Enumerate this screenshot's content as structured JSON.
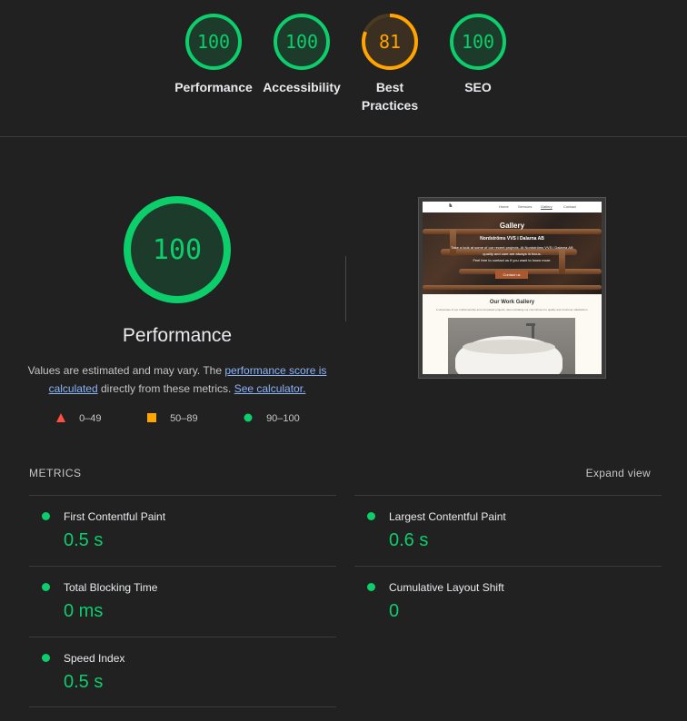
{
  "categories": [
    {
      "score": "100",
      "label_line1": "Performance",
      "label_line2": "",
      "color": "#0cce6b",
      "fraction": 1.0
    },
    {
      "score": "100",
      "label_line1": "Accessibility",
      "label_line2": "",
      "color": "#0cce6b",
      "fraction": 1.0
    },
    {
      "score": "81",
      "label_line1": "Best",
      "label_line2": "Practices",
      "color": "#ffa400",
      "fraction": 0.81
    },
    {
      "score": "100",
      "label_line1": "SEO",
      "label_line2": "",
      "color": "#0cce6b",
      "fraction": 1.0
    }
  ],
  "main": {
    "score": "100",
    "title": "Performance",
    "desc_prefix": "Values are estimated and may vary. The ",
    "desc_link1": "performance score is calculated",
    "desc_middle": " directly from these metrics. ",
    "desc_link2": "See calculator.",
    "legend": [
      {
        "range": "0–49",
        "shape": "triangle",
        "color": "#ff4e42"
      },
      {
        "range": "50–89",
        "shape": "square",
        "color": "#ffa400"
      },
      {
        "range": "90–100",
        "shape": "circle",
        "color": "#0cce6b"
      }
    ]
  },
  "screenshot": {
    "nav": [
      "Home",
      "Services",
      "Gallery",
      "Contact"
    ],
    "hero_title": "Gallery",
    "hero_subtitle": "Nordströms VVS i Dalarna AB",
    "hero_text1": "Take a look at some of our recent projects. At Nordströms VVS i Dalarna AB",
    "hero_text2": "quality and care are always in focus.",
    "hero_text3": "Feel free to contact us if you want to know more.",
    "hero_button": "Contact us",
    "gallery_title": "Our Work Gallery",
    "gallery_sub": "A showcase of our craftsmanship and completed projects, demonstrating our commitment to quality and customer satisfaction."
  },
  "metrics": {
    "title": "METRICS",
    "expand": "Expand view",
    "items": [
      {
        "name": "First Contentful Paint",
        "value": "0.5 s"
      },
      {
        "name": "Largest Contentful Paint",
        "value": "0.6 s"
      },
      {
        "name": "Total Blocking Time",
        "value": "0 ms"
      },
      {
        "name": "Cumulative Layout Shift",
        "value": "0"
      },
      {
        "name": "Speed Index",
        "value": "0.5 s"
      }
    ]
  }
}
